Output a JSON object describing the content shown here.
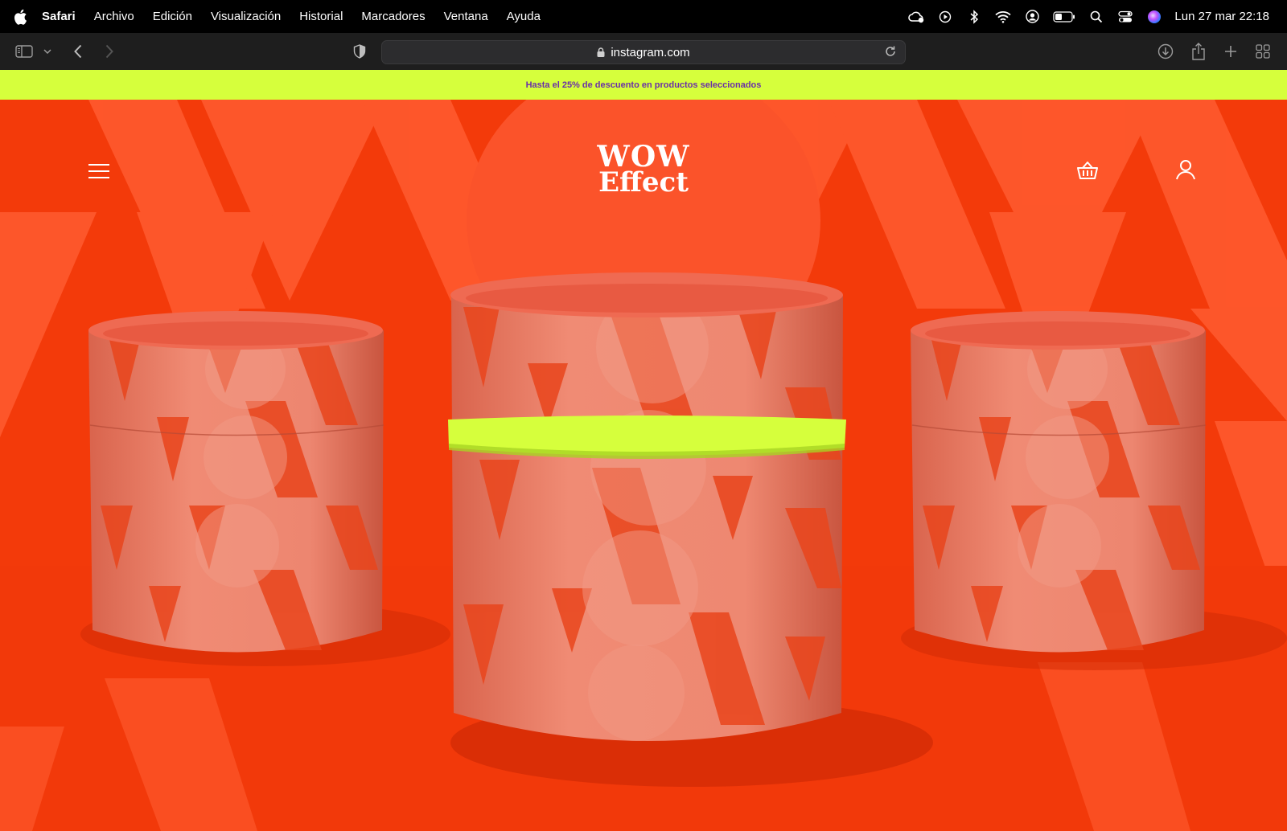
{
  "menubar": {
    "app_name": "Safari",
    "menu_items": [
      "Archivo",
      "Edición",
      "Visualización",
      "Historial",
      "Marcadores",
      "Ventana",
      "Ayuda"
    ],
    "clock": "Lun 27 mar  22:18",
    "status_icons": [
      "creative-cloud-icon",
      "play-icon",
      "bluetooth-icon",
      "wifi-icon",
      "user-circle-icon",
      "battery-icon",
      "spotlight-search-icon",
      "control-center-icon",
      "siri-icon"
    ]
  },
  "browser": {
    "url": "instagram.com"
  },
  "promo": {
    "text": "Hasta el 25% de descuento en productos seleccionados"
  },
  "site": {
    "logo_line1": "WOW",
    "logo_line2": "Effect"
  },
  "colors": {
    "brand_orange": "#f33a0a",
    "accent_lime": "#d6ff3c",
    "promo_text": "#6a2fa8"
  }
}
